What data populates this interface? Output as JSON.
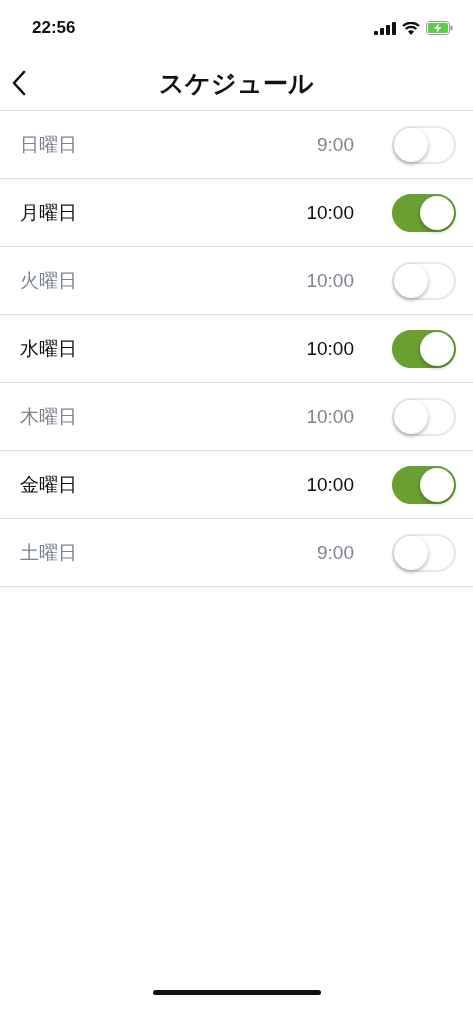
{
  "status_bar": {
    "time": "22:56"
  },
  "nav": {
    "title": "スケジュール"
  },
  "schedule": [
    {
      "day": "日曜日",
      "time": "9:00",
      "on": false
    },
    {
      "day": "月曜日",
      "time": "10:00",
      "on": true
    },
    {
      "day": "火曜日",
      "time": "10:00",
      "on": false
    },
    {
      "day": "水曜日",
      "time": "10:00",
      "on": true
    },
    {
      "day": "木曜日",
      "time": "10:00",
      "on": false
    },
    {
      "day": "金曜日",
      "time": "10:00",
      "on": true
    },
    {
      "day": "土曜日",
      "time": "9:00",
      "on": false
    }
  ]
}
